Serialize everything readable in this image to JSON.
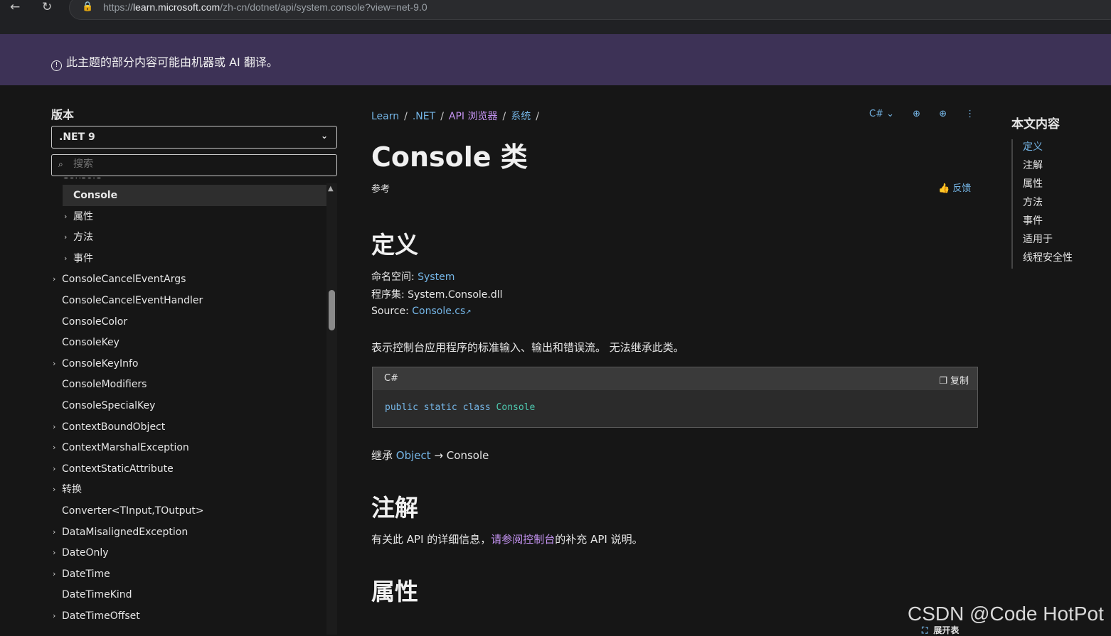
{
  "browser": {
    "back_glyph": "←",
    "reload_glyph": "↻",
    "lock_glyph": "🔒",
    "url_prefix": "https://",
    "url_host": "learn.microsoft.com",
    "url_path": "/zh-cn/dotnet/api/system.console?view=net-9.0"
  },
  "banner": {
    "text": "此主题的部分内容可能由机器或 AI 翻译。",
    "icon": "!"
  },
  "sidebar": {
    "title": "版本",
    "version": ".NET 9",
    "version_chevron": "⌄",
    "search_placeholder": "搜索",
    "search_icon": "⌕",
    "tree": [
      {
        "label": "Console",
        "indent": 1,
        "chevron": "˅",
        "selected": false
      },
      {
        "label": "Console",
        "indent": 2,
        "chevron": "",
        "selected": true
      },
      {
        "label": "属性",
        "indent": 2,
        "chevron": "›",
        "selected": false
      },
      {
        "label": "方法",
        "indent": 2,
        "chevron": "›",
        "selected": false
      },
      {
        "label": "事件",
        "indent": 2,
        "chevron": "›",
        "selected": false
      },
      {
        "label": "ConsoleCancelEventArgs",
        "indent": 1,
        "chevron": "›",
        "selected": false
      },
      {
        "label": "ConsoleCancelEventHandler",
        "indent": 1,
        "chevron": "",
        "selected": false
      },
      {
        "label": "ConsoleColor",
        "indent": 1,
        "chevron": "",
        "selected": false
      },
      {
        "label": "ConsoleKey",
        "indent": 1,
        "chevron": "",
        "selected": false
      },
      {
        "label": "ConsoleKeyInfo",
        "indent": 1,
        "chevron": "›",
        "selected": false
      },
      {
        "label": "ConsoleModifiers",
        "indent": 1,
        "chevron": "",
        "selected": false
      },
      {
        "label": "ConsoleSpecialKey",
        "indent": 1,
        "chevron": "",
        "selected": false
      },
      {
        "label": "ContextBoundObject",
        "indent": 1,
        "chevron": "›",
        "selected": false
      },
      {
        "label": "ContextMarshalException",
        "indent": 1,
        "chevron": "›",
        "selected": false
      },
      {
        "label": "ContextStaticAttribute",
        "indent": 1,
        "chevron": "›",
        "selected": false
      },
      {
        "label": "转换",
        "indent": 1,
        "chevron": "›",
        "selected": false
      },
      {
        "label": "Converter<TInput,TOutput>",
        "indent": 1,
        "chevron": "",
        "selected": false
      },
      {
        "label": "DataMisalignedException",
        "indent": 1,
        "chevron": "›",
        "selected": false
      },
      {
        "label": "DateOnly",
        "indent": 1,
        "chevron": "›",
        "selected": false
      },
      {
        "label": "DateTime",
        "indent": 1,
        "chevron": "›",
        "selected": false
      },
      {
        "label": "DateTimeKind",
        "indent": 1,
        "chevron": "",
        "selected": false
      },
      {
        "label": "DateTimeOffset",
        "indent": 1,
        "chevron": "›",
        "selected": false
      }
    ],
    "scroll_up_glyph": "▲"
  },
  "main": {
    "breadcrumbs": [
      {
        "label": "Learn"
      },
      {
        "label": ".NET"
      },
      {
        "label": "API 浏览器"
      },
      {
        "label": "系统"
      }
    ],
    "breadcrumb_sep": "/",
    "lang_switch": "C# ⌄",
    "globe_icon": "⊕",
    "add_icon": "⊕",
    "more_icon": "⋮",
    "title": "Console 类",
    "reference": "参考",
    "feedback": "反馈",
    "feedback_icon": "👍",
    "definition_heading": "定义",
    "namespace_label": "命名空间:",
    "namespace_value": "System",
    "assembly_label": "程序集:",
    "assembly_value": "System.Console.dll",
    "source_label": "Source:",
    "source_value": "Console.cs",
    "external_glyph": "↗",
    "description": "表示控制台应用程序的标准输入、输出和错误流。 无法继承此类。",
    "code": {
      "lang": "C#",
      "copy": "复制",
      "copy_icon": "❐",
      "keywords": "public static class ",
      "class_name": "Console"
    },
    "inherit_label": "继承",
    "inherit_base": "Object",
    "inherit_arrow": "→",
    "inherit_self": "Console",
    "remarks_heading": "注解",
    "remarks_prefix": "有关此 API 的详细信息，",
    "remarks_link": "请参阅控制台",
    "remarks_suffix": "的补充 API 说明。",
    "properties_heading": "属性"
  },
  "toc": {
    "title": "本文内容",
    "items": [
      {
        "label": "定义",
        "active": true
      },
      {
        "label": "注解",
        "active": false
      },
      {
        "label": "属性",
        "active": false
      },
      {
        "label": "方法",
        "active": false
      },
      {
        "label": "事件",
        "active": false
      },
      {
        "label": "适用于",
        "active": false
      },
      {
        "label": "线程安全性",
        "active": false
      }
    ]
  },
  "overlay": {
    "watermark": "CSDN @Code HotPot",
    "expand_label": "展开表",
    "expand_icon": "⛶"
  },
  "colors": {
    "banner_bg": "#3d3256",
    "link": "#75b6e7",
    "visited_link": "#c392f0",
    "page_bg": "#161616"
  }
}
